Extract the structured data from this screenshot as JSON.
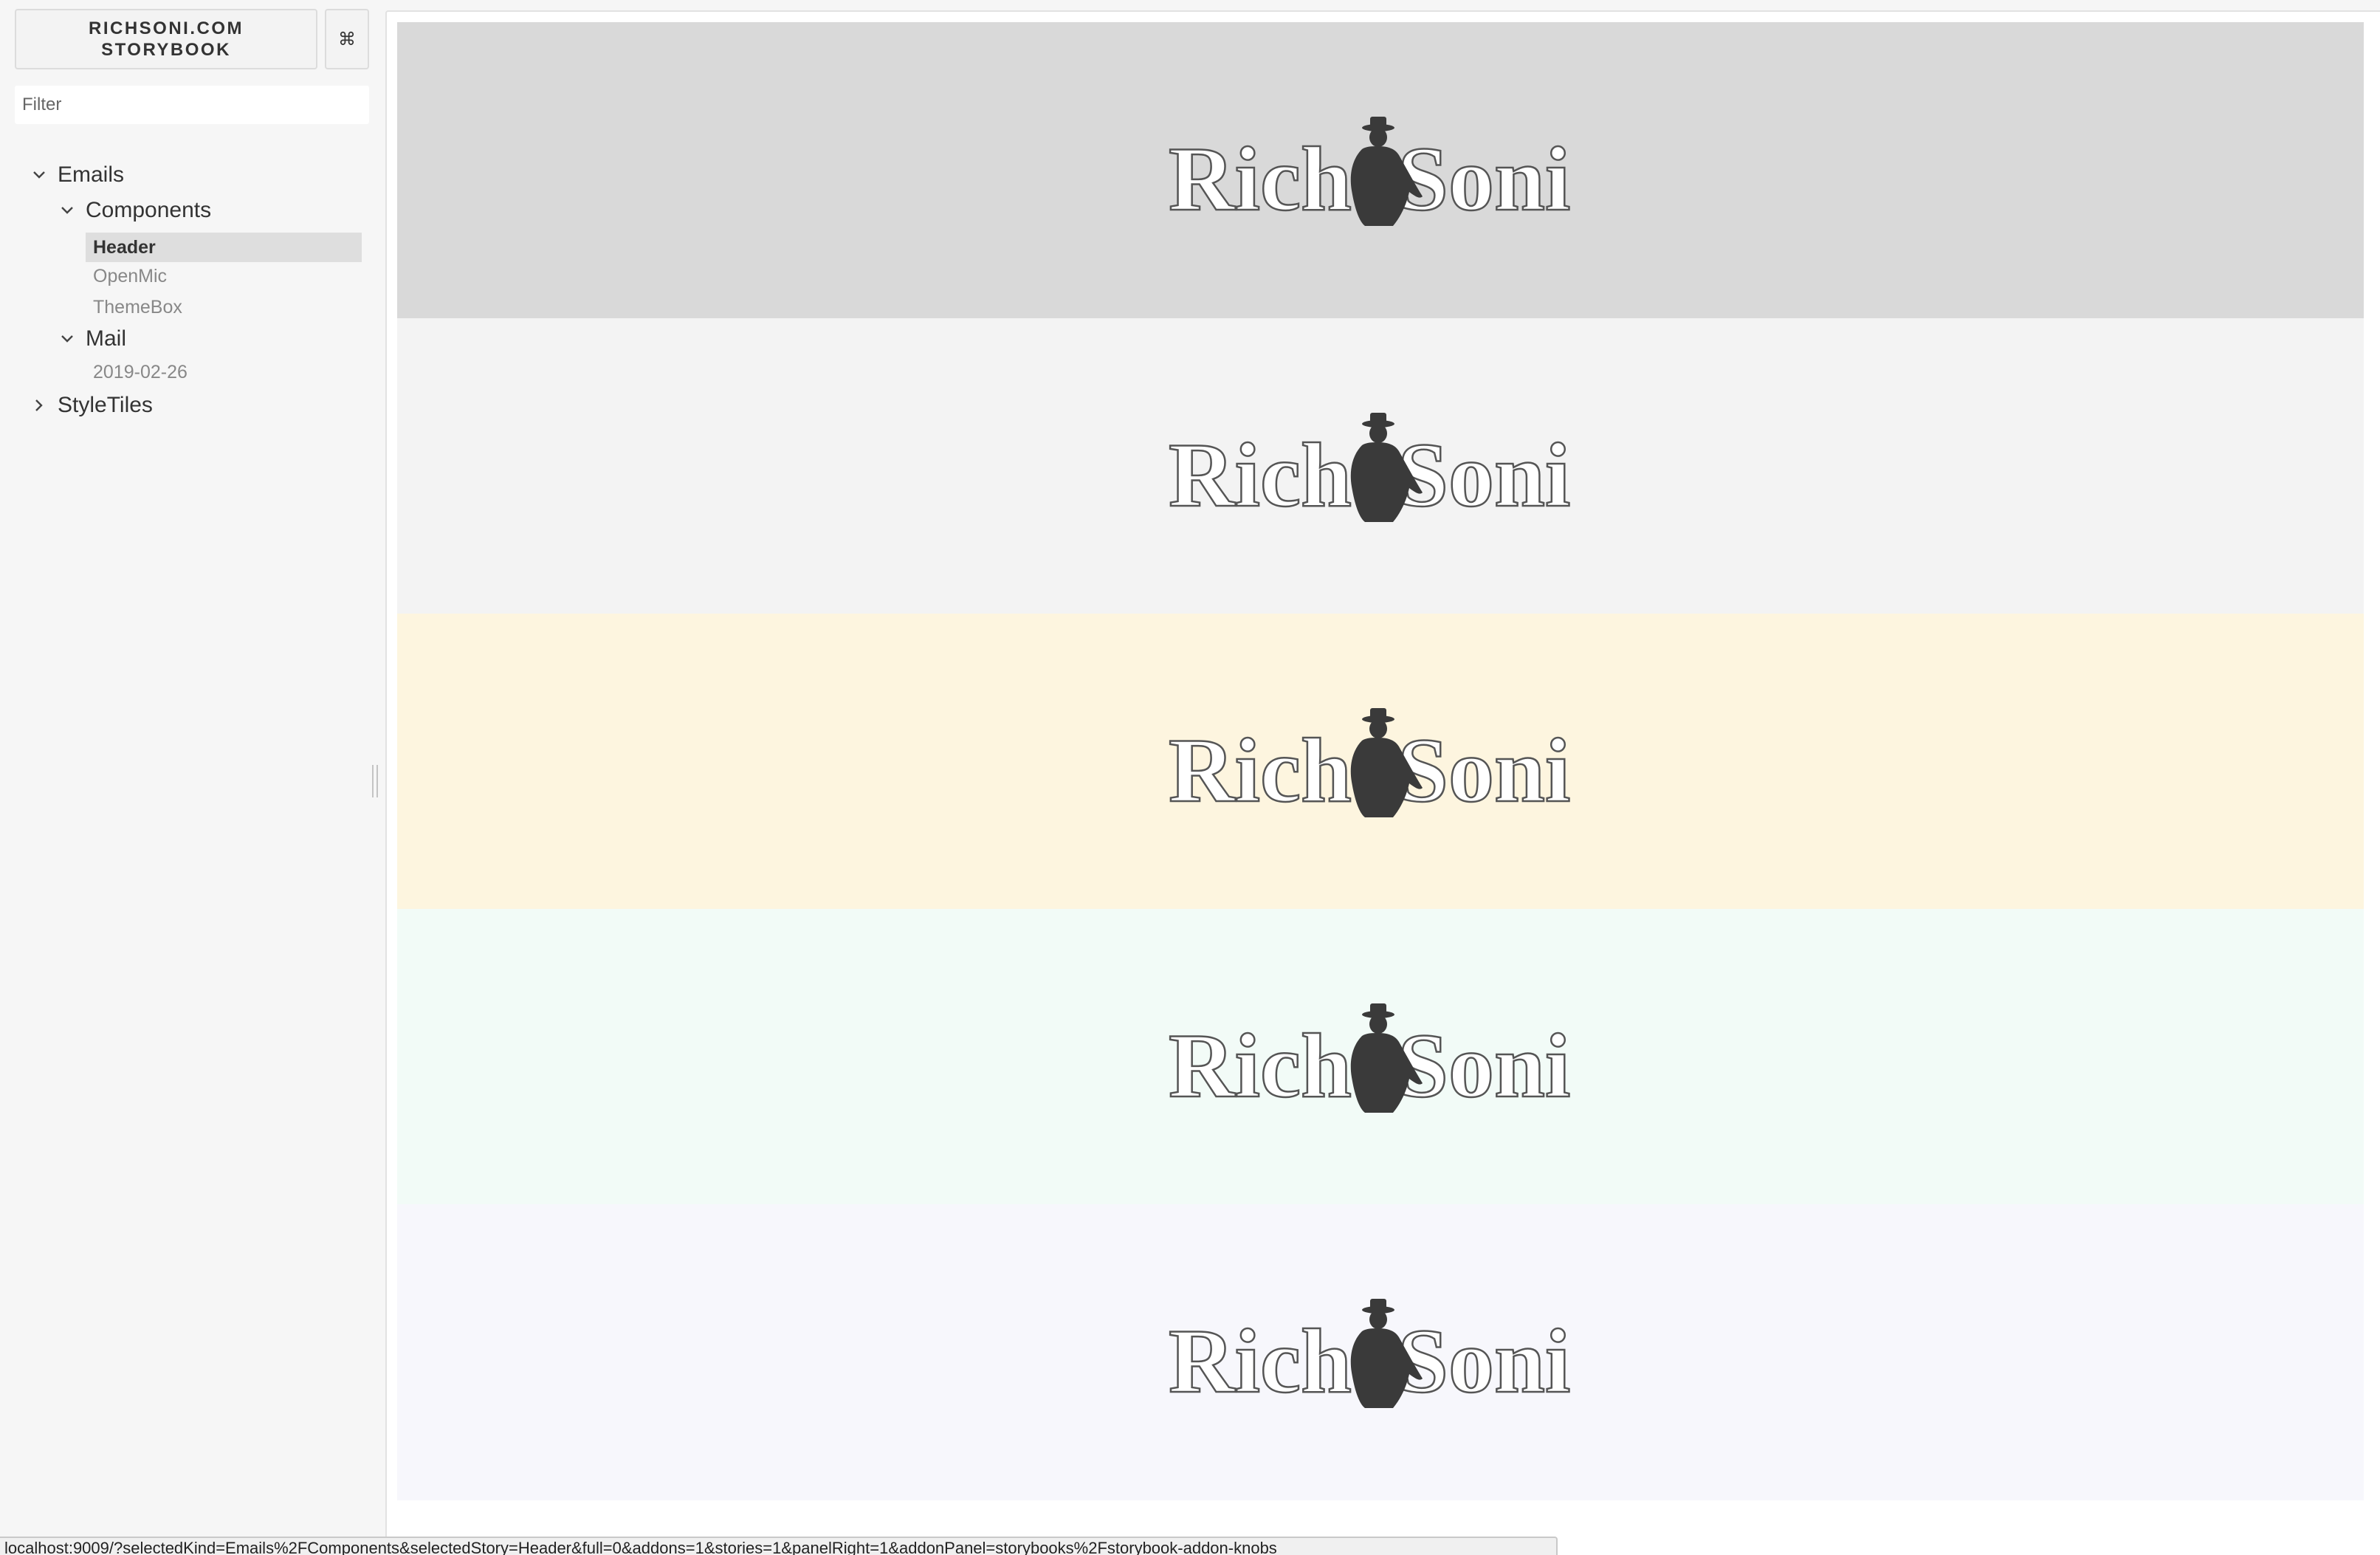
{
  "brand": {
    "title": "RICHSONI.COM STORYBOOK"
  },
  "shortcuts": {
    "glyph": "⌘",
    "icon": "command-icon"
  },
  "filter": {
    "placeholder": "Filter",
    "value": ""
  },
  "tree": {
    "emails": {
      "label": "Emails",
      "expanded": true
    },
    "components": {
      "label": "Components",
      "expanded": true
    },
    "header": {
      "label": "Header",
      "selected": true
    },
    "openmic": {
      "label": "OpenMic"
    },
    "themebox": {
      "label": "ThemeBox"
    },
    "mail": {
      "label": "Mail",
      "expanded": true
    },
    "mail_date": {
      "label": "2019-02-26"
    },
    "styletiles": {
      "label": "StyleTiles",
      "expanded": false
    }
  },
  "preview": {
    "bands": [
      {
        "name": "grey",
        "background": "#d9d9d9"
      },
      {
        "name": "light",
        "background": "#f3f3f3"
      },
      {
        "name": "cream",
        "background": "#fdf5df"
      },
      {
        "name": "mint",
        "background": "#f2fbf7"
      },
      {
        "name": "violet",
        "background": "#f7f7fc"
      }
    ],
    "logo": {
      "word_left": "Rich",
      "word_right": "Soni",
      "silhouette_color": "#3a3a3a",
      "outline_color": "#555555",
      "fill_color": "#ffffff"
    }
  },
  "status": {
    "url": "localhost:9009/?selectedKind=Emails%2FComponents&selectedStory=Header&full=0&addons=1&stories=1&panelRight=1&addonPanel=storybooks%2Fstorybook-addon-knobs"
  }
}
